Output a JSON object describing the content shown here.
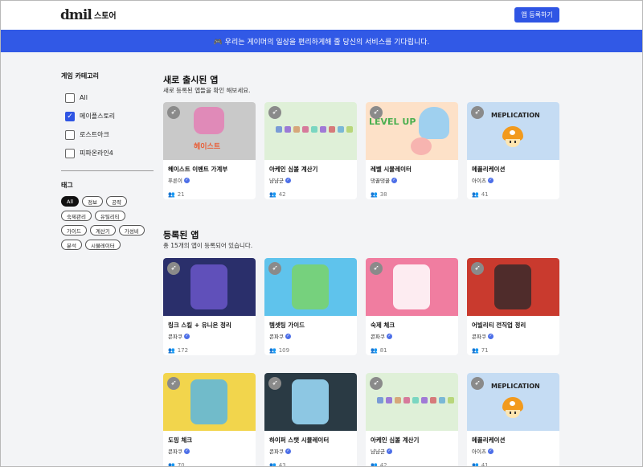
{
  "header": {
    "logo": "dmil",
    "nav_store": "스토어",
    "register_button": "앱 등록하기"
  },
  "banner": {
    "icon": "gamepad-icon",
    "text": "🎮 우리는 게이머의 일상을 편리하게해 줄 당신의 서비스를 기다립니다."
  },
  "sidebar": {
    "category_title": "게임 카테고리",
    "categories": [
      {
        "label": "All",
        "checked": false
      },
      {
        "label": "메이플스토리",
        "checked": true
      },
      {
        "label": "로스트아크",
        "checked": false
      },
      {
        "label": "피파온라인4",
        "checked": false
      }
    ],
    "tag_title": "태그",
    "tags": [
      "All",
      "정보",
      "공략",
      "숙제관리",
      "유틸리티",
      "가이드",
      "계산기",
      "가성비",
      "분석",
      "시뮬레이터"
    ],
    "active_tag": "All"
  },
  "new_section": {
    "title": "새로 출시된 앱",
    "subtitle": "새로 등록된 앱들을 확인 해보세요."
  },
  "registered_section": {
    "title": "등록된 앱",
    "subtitle": "총 15개의 앱이 등록되어 있습니다."
  },
  "new_apps": [
    {
      "title": "헤이스트 이벤트 가계부",
      "author": "푸른이",
      "count": "21",
      "art_text": "헤이스트",
      "bg": "#c9c9c9"
    },
    {
      "title": "아케인 심볼 계산기",
      "author": "냠냠군",
      "count": "42",
      "art_text": "",
      "bg": "#dff0d8"
    },
    {
      "title": "레벨 시뮬레이터",
      "author": "댕꿀댕꿀",
      "count": "38",
      "art_text": "LEVEL UP",
      "bg": "#fde1c8"
    },
    {
      "title": "메플리케이션",
      "author": "아이츠",
      "count": "41",
      "art_text": "MEPLICATION",
      "bg": "#c5dcf3"
    }
  ],
  "registered_apps": [
    {
      "title": "링크 스킬 + 유니온 정리",
      "author": "콘파쿠",
      "count": "172",
      "art_text": "",
      "bg": "#2a2f6b"
    },
    {
      "title": "템셋팅 가이드",
      "author": "콘파쿠",
      "count": "109",
      "art_text": "",
      "bg": "#5fc3ec"
    },
    {
      "title": "숙제 체크",
      "author": "콘파쿠",
      "count": "81",
      "art_text": "",
      "bg": "#f07da0"
    },
    {
      "title": "어빌리티 전직업 정리",
      "author": "콘파쿠",
      "count": "71",
      "art_text": "",
      "bg": "#c93a2e"
    },
    {
      "title": "도핑 체크",
      "author": "콘파쿠",
      "count": "70",
      "art_text": "",
      "bg": "#f2d54c"
    },
    {
      "title": "하이퍼 스탯 시뮬레이터",
      "author": "콘파쿠",
      "count": "43",
      "art_text": "",
      "bg": "#2a3a44"
    },
    {
      "title": "아케인 심볼 계산기",
      "author": "냠냠군",
      "count": "42",
      "art_text": "",
      "bg": "#dff0d8"
    },
    {
      "title": "메플리케이션",
      "author": "아이츠",
      "count": "41",
      "art_text": "MEPLICATION",
      "bg": "#c5dcf3"
    }
  ],
  "colors": {
    "accent": "#2f55e4",
    "banner": "#3159e6",
    "page_bg": "#f3f4f6"
  }
}
